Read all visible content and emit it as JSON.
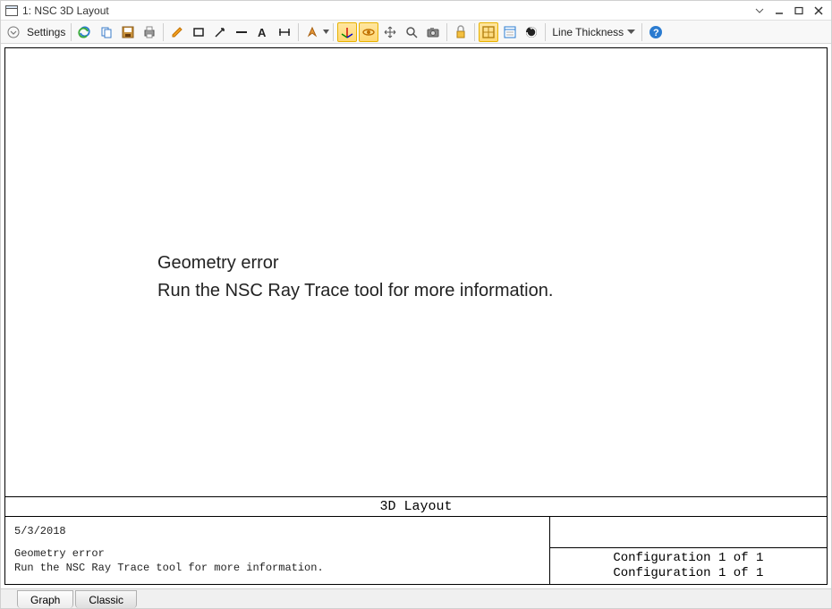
{
  "window": {
    "title": "1: NSC 3D Layout"
  },
  "toolbar": {
    "settings_label": "Settings",
    "line_thickness_label": "Line Thickness"
  },
  "canvas": {
    "error_line1": "Geometry error",
    "error_line2": "Run the NSC Ray Trace tool for more information.",
    "layout_title": "3D Layout",
    "date": "5/3/2018",
    "detail_line1": "Geometry error",
    "detail_line2": "Run the NSC Ray Trace tool for more information.",
    "config_line1": "Configuration 1 of 1",
    "config_line2": "Configuration 1 of 1"
  },
  "tabs": {
    "graph": "Graph",
    "classic": "Classic"
  }
}
